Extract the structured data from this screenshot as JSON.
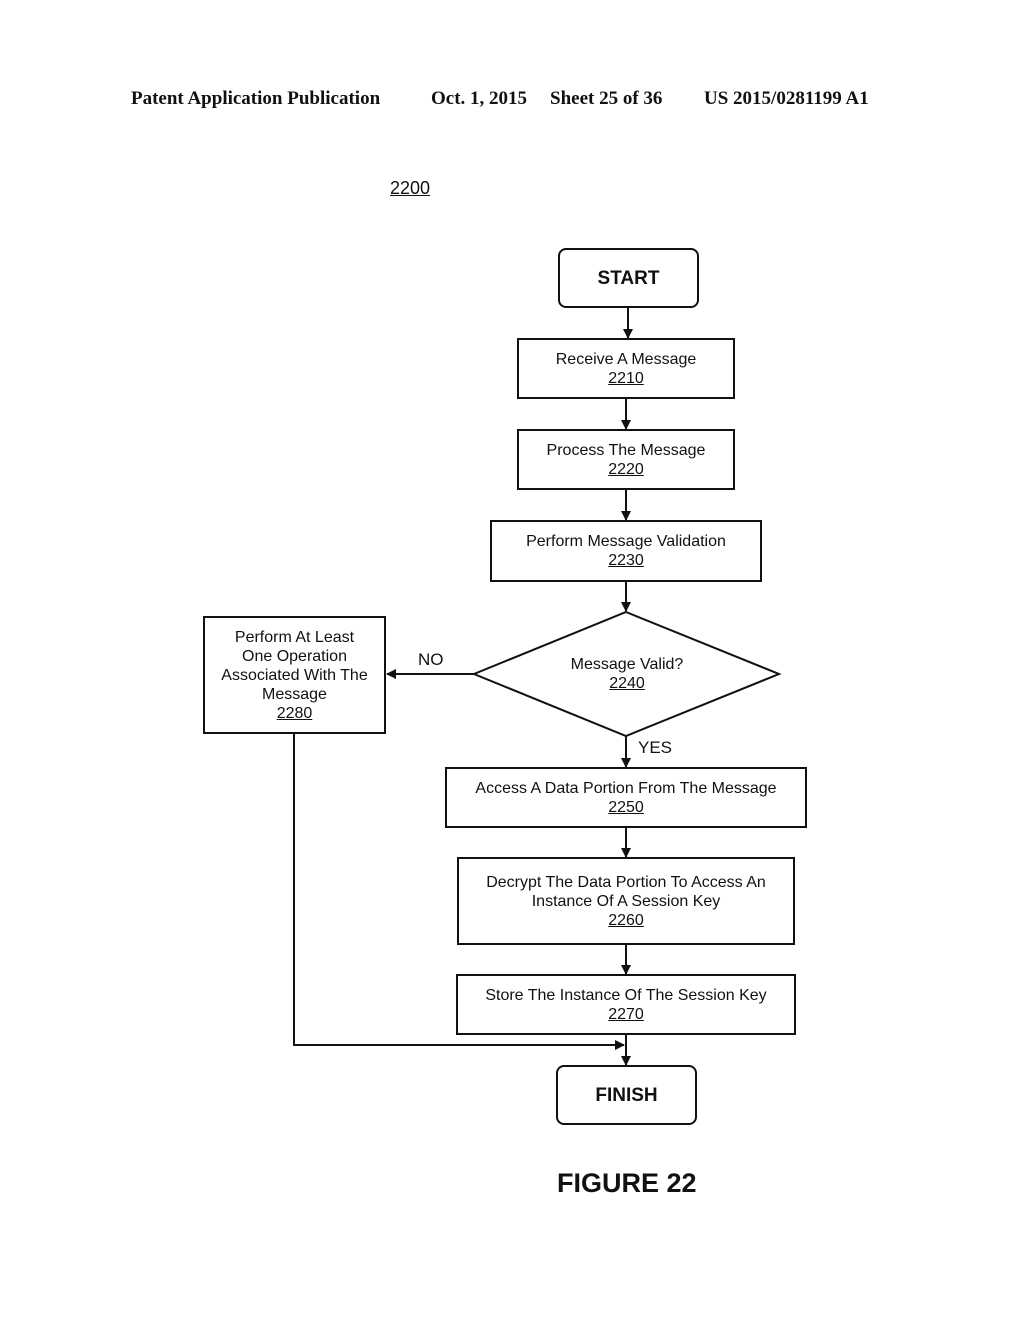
{
  "header": {
    "publication": "Patent Application Publication",
    "date": "Oct. 1, 2015",
    "sheet": "Sheet 25 of 36",
    "number": "US 2015/0281199 A1"
  },
  "figure_ref": "2200",
  "nodes": {
    "start": {
      "label": "START"
    },
    "n2210": {
      "label": "Receive A Message",
      "ref": "2210"
    },
    "n2220": {
      "label": "Process The Message",
      "ref": "2220"
    },
    "n2230": {
      "label": "Perform Message Validation",
      "ref": "2230"
    },
    "n2240": {
      "label": "Message Valid?",
      "ref": "2240"
    },
    "n2250": {
      "label": "Access A Data Portion From The Message",
      "ref": "2250"
    },
    "n2260": {
      "label_line1": "Decrypt The Data Portion To Access An",
      "label_line2": "Instance Of A Session Key",
      "ref": "2260"
    },
    "n2270": {
      "label": "Store The Instance Of The Session Key",
      "ref": "2270"
    },
    "n2280": {
      "label_line1": "Perform At Least",
      "label_line2": "One Operation",
      "label_line3": "Associated With The",
      "label_line4": "Message",
      "ref": "2280"
    },
    "finish": {
      "label": "FINISH"
    }
  },
  "edges": {
    "no_label": "NO",
    "yes_label": "YES"
  },
  "figure_caption": "FIGURE 22"
}
